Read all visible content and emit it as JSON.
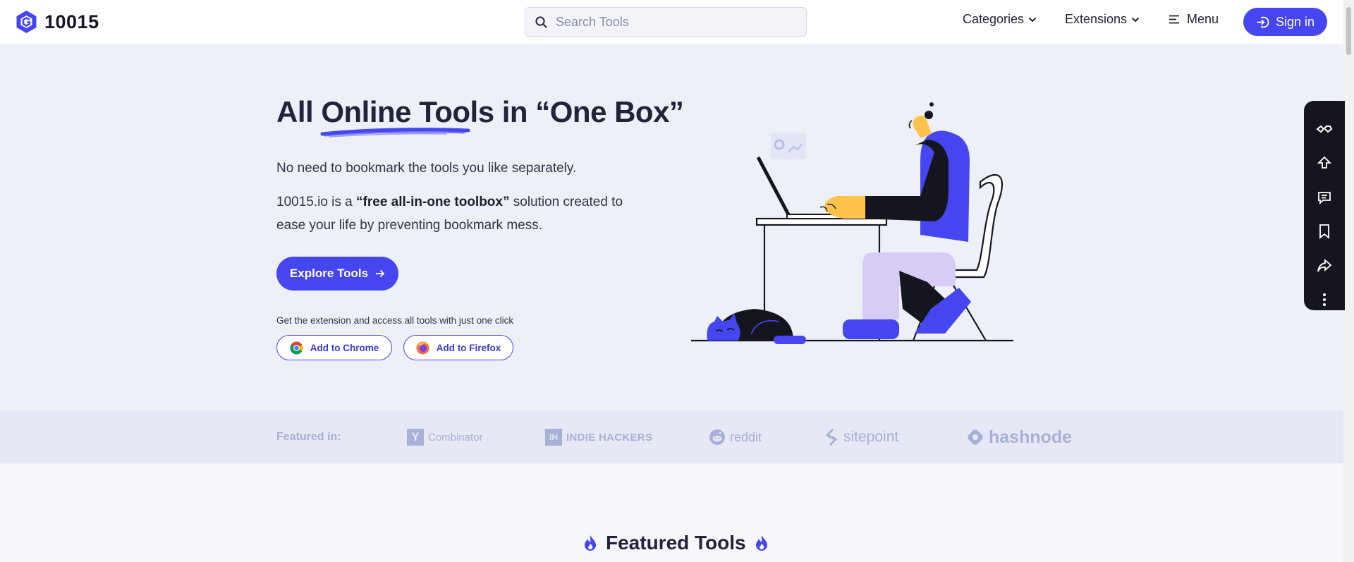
{
  "header": {
    "logo_text": "10015",
    "search_placeholder": "Search Tools",
    "nav": {
      "categories": "Categories",
      "extensions": "Extensions",
      "menu": "Menu"
    },
    "signin_label": "Sign in"
  },
  "hero": {
    "title_pre": "All ",
    "title_highlight": "Online Tools",
    "title_post": " in “One Box”",
    "para1": "No need to bookmark the tools you like separately.",
    "para2_pre": "10015.io is a ",
    "para2_bold": "“free all-in-one toolbox”",
    "para2_post": " solution created to ease your life by preventing bookmark mess.",
    "explore_label": "Explore Tools",
    "extension_note": "Get the extension and access all tools with just one click",
    "chrome_label": "Add to Chrome",
    "firefox_label": "Add to Firefox"
  },
  "side_toolbar": {
    "icons": [
      "handshake-icon",
      "upload-icon",
      "comment-icon",
      "bookmark-icon",
      "share-icon",
      "more-vertical-icon"
    ]
  },
  "featured_in": {
    "label": "Featured in:",
    "partners": [
      "Combinator",
      "INDIE HACKERS",
      "reddit",
      "sitepoint",
      "hashnode"
    ],
    "partner_marks": {
      "ycombinator": "Y",
      "indiehackers": "IH"
    }
  },
  "featured_tools": {
    "title": "Featured Tools"
  },
  "colors": {
    "accent": "#4646f0",
    "hero_bg": "#eef0f8",
    "strip_bg": "#e6e9f5",
    "partner_text": "#a7b0d6",
    "dark": "#15151f"
  }
}
